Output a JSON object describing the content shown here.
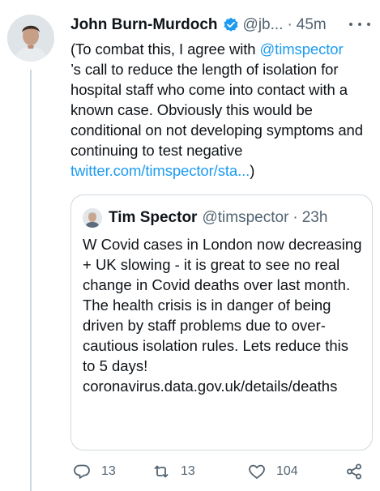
{
  "tweet": {
    "author_name": "John Burn-Murdoch",
    "author_handle": "@jb...",
    "separator": "·",
    "time": "45m",
    "text_before": "(To combat this, I agree with ",
    "mention": "@timspector",
    "text_middle": "\n’s call to reduce the length of isolation for hospital staff who come into contact with a known case. Obviously this would be conditional on not developing symptoms and continuing to test negative\n",
    "link": "twitter.com/timspector/sta...",
    "text_after": ")"
  },
  "quote": {
    "author_name": "Tim Spector",
    "author_handle": "@timspector",
    "separator": "·",
    "time": "23h",
    "text": "W Covid cases in London now decreasing + UK slowing - it is great to see no real change in Covid deaths over last month. The health crisis is in danger of being driven by staff problems due to over- cautious isolation rules. Lets reduce this to 5 days!",
    "url": "coronavirus.data.gov.uk/details/deaths"
  },
  "actions": {
    "reply_count": "13",
    "retweet_count": "13",
    "like_count": "104"
  },
  "colors": {
    "link": "#1d9bf0",
    "secondary_text": "#536471",
    "border": "#cfd9de",
    "verified": "#1d9bf0"
  },
  "icons": {
    "verified": "verified-badge-icon",
    "more": "more-dots-icon",
    "reply": "reply-icon",
    "retweet": "retweet-icon",
    "like": "heart-icon",
    "share": "share-icon"
  }
}
